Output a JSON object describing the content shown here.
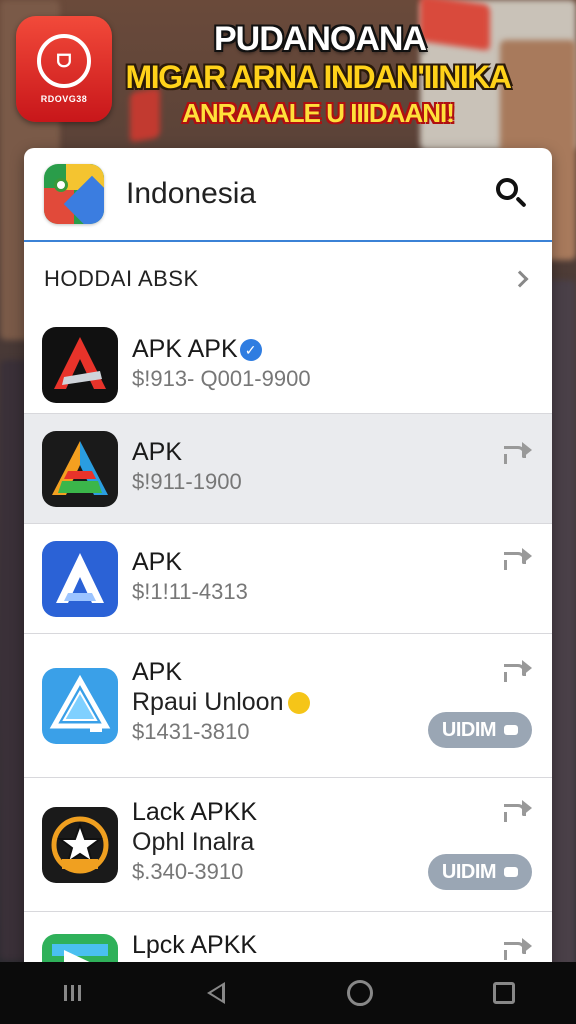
{
  "banner": {
    "logo_text": "RDOVG38",
    "headline_1": "PUDANOANA",
    "headline_2": "MIGAR ARNA INDAN'IINIKA",
    "headline_3": "ANRAAALE U IIIDAANI!",
    "colors": {
      "logo": "#e0201e",
      "headline_yellow": "#ffd21a"
    }
  },
  "search": {
    "query": "Indonesia",
    "app_icon": "maps-icon",
    "button_icon": "search-icon",
    "accent": "#3b82d6"
  },
  "section": {
    "title": "HODDAI ABSK"
  },
  "apps": [
    {
      "name": "APK APK",
      "price": "$!913- Q001-9900",
      "icon": "red-a-logo-icon",
      "verified": true
    },
    {
      "name": "APK",
      "price": "$!911-1900",
      "icon": "rainbow-a-logo-icon",
      "selected": true
    },
    {
      "name": "APK",
      "price": "$!1!11-4313",
      "icon": "blue-a-logo-icon"
    },
    {
      "name": "APK",
      "subtitle": "Rpaui Unloon",
      "price": "$1431-3810",
      "icon": "triangle-logo-icon",
      "action": "UIDIM"
    },
    {
      "name": "Lack APKK",
      "subtitle": "Ophl Inalra",
      "price": "$.340-3910",
      "icon": "star-badge-icon",
      "action": "UIDIM"
    },
    {
      "name": "Lpck APKK",
      "icon": "green-arrow-icon"
    }
  ],
  "navbar": {
    "buttons": [
      "recents-icon",
      "back-icon",
      "home-icon",
      "overview-icon"
    ]
  }
}
